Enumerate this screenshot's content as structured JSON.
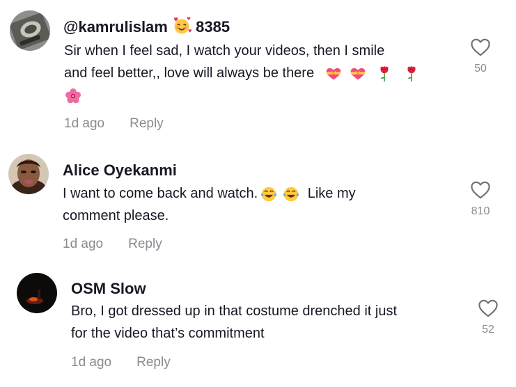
{
  "comments": [
    {
      "author": "@kamrulislam",
      "author_emoji": "smiling-face-with-hearts",
      "author_suffix": "8385",
      "line1": "Sir when I feel sad, I watch your videos, then I smile",
      "line2": "and feel better,, love will always be there",
      "emojis": [
        "heart-with-ribbon",
        "heart-with-ribbon",
        "rose",
        "rose",
        "hibiscus"
      ],
      "time": "1d ago",
      "reply": "Reply",
      "likes": "50"
    },
    {
      "author": "Alice Oyekanmi",
      "line1_a": "I want to come back and watch.",
      "line1_b": "Like my",
      "emojis": [
        "tears-of-joy",
        "tears-of-joy"
      ],
      "line2": "comment please.",
      "time": "1d ago",
      "reply": "Reply",
      "likes": "810"
    },
    {
      "author": "OSM Slow",
      "line1": "Bro, I got dressed up in that costume drenched it just",
      "line2": "for the video that’s commitment",
      "time": "1d ago",
      "reply": "Reply",
      "likes": "52"
    }
  ],
  "colors": {
    "text": "#161823",
    "muted": "#8a8b91",
    "heart_outline": "#6f7077"
  }
}
